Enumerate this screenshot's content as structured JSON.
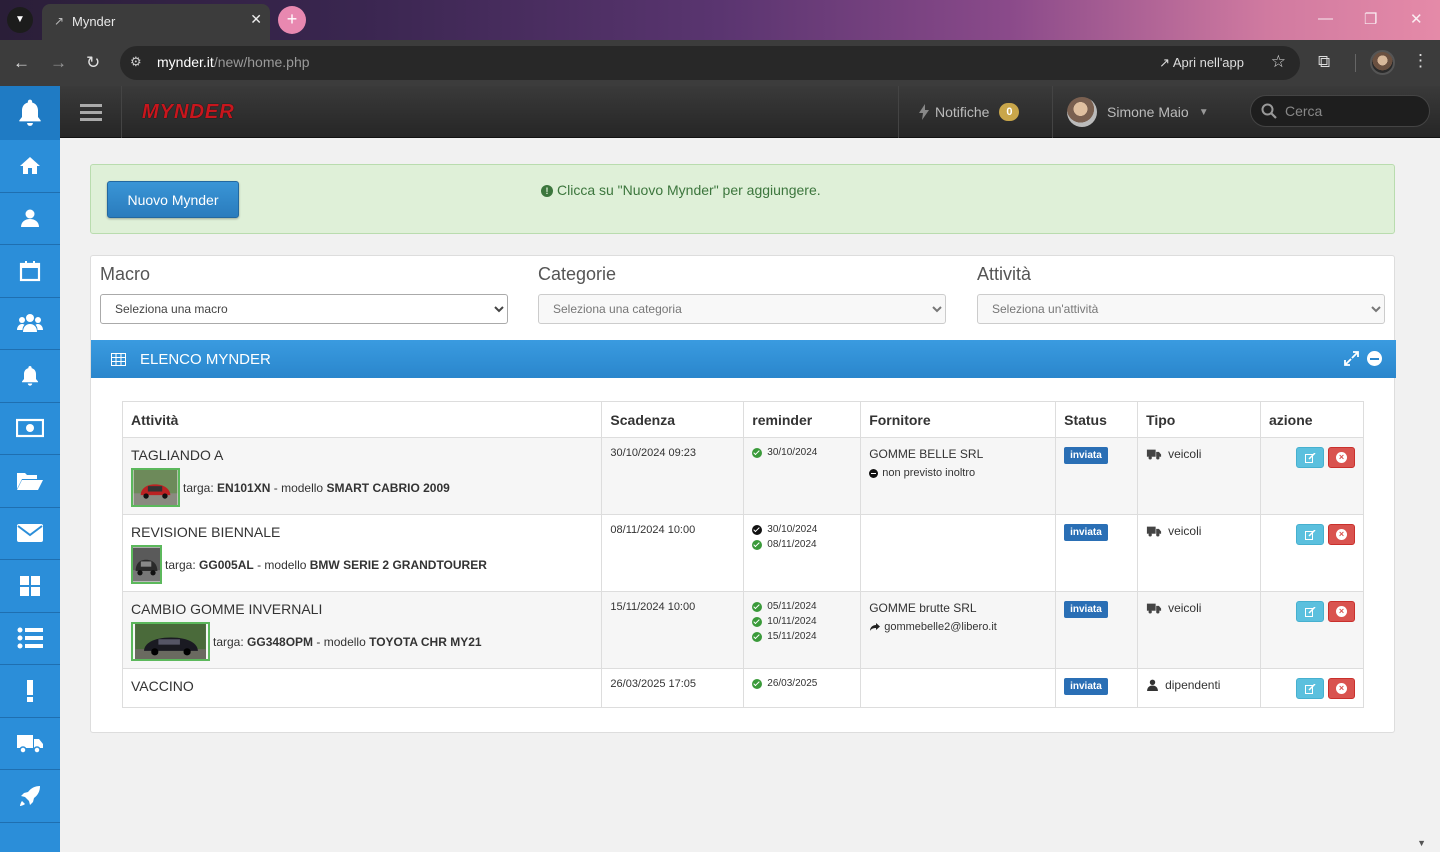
{
  "browser": {
    "tab_title": "Mynder",
    "url_domain": "mynder.it",
    "url_path": "/new/home.php",
    "open_in_app": "Apri nell'app"
  },
  "header": {
    "logo": "MYNDER",
    "notifications_label": "Notifiche",
    "notifications_count": "0",
    "user_name": "Simone Maio",
    "search_placeholder": "Cerca"
  },
  "alert": {
    "button_label": "Nuovo Mynder",
    "message": "Clicca su \"Nuovo Mynder\" per aggiungere."
  },
  "filters": {
    "macro_label": "Macro",
    "macro_value": "Seleziona una macro",
    "categorie_label": "Categorie",
    "categorie_value": "Seleziona una categoria",
    "attivita_label": "Attività",
    "attivita_value": "Seleziona un'attività"
  },
  "panel": {
    "title": "ELENCO MYNDER"
  },
  "table": {
    "headers": [
      "Attività",
      "Scadenza",
      "reminder",
      "Fornitore",
      "Status",
      "Tipo",
      "azione"
    ],
    "rows": [
      {
        "attivita": "TAGLIANDO A",
        "targa_label": "targa:",
        "targa": "EN101XN",
        "modello_label": "- modello",
        "modello": "SMART CABRIO 2009",
        "scadenza": "30/10/2024 09:23",
        "reminders": [
          "30/10/2024"
        ],
        "fornitore": "GOMME BELLE SRL",
        "fornitore_note": "non previsto inoltro",
        "status": "inviata",
        "tipo": "veicoli"
      },
      {
        "attivita": "REVISIONE BIENNALE",
        "targa_label": "targa:",
        "targa": "GG005AL",
        "modello_label": "- modello",
        "modello": "BMW SERIE 2 GRANDTOURER",
        "scadenza": "08/11/2024 10:00",
        "reminders": [
          "30/10/2024",
          "08/11/2024"
        ],
        "fornitore": "",
        "fornitore_note": "",
        "status": "inviata",
        "tipo": "veicoli"
      },
      {
        "attivita": "CAMBIO GOMME INVERNALI",
        "targa_label": "targa:",
        "targa": "GG348OPM",
        "modello_label": "- modello",
        "modello": "TOYOTA CHR MY21",
        "scadenza": "15/11/2024 10:00",
        "reminders": [
          "05/11/2024",
          "10/11/2024",
          "15/11/2024"
        ],
        "fornitore": "GOMME brutte SRL",
        "fornitore_note": "gommebelle2@libero.it",
        "status": "inviata",
        "tipo": "veicoli"
      },
      {
        "attivita": "VACCINO",
        "scadenza": "26/03/2025 17:05",
        "reminders": [
          "26/03/2025"
        ],
        "fornitore": "",
        "status": "inviata",
        "tipo": "dipendenti"
      }
    ]
  },
  "colors": {
    "sidebar": "#2b8ed9",
    "panel_header": "#2a86cc",
    "alert_bg": "#dff0d8",
    "status_label": "#2a6fb5",
    "edit_button": "#5bc0de",
    "delete_button": "#d9534f",
    "logo": "#c8161d"
  },
  "icons": {
    "sidebar": [
      "bell-icon",
      "home-icon",
      "user-icon",
      "calendar-icon",
      "users-icon",
      "bell-icon",
      "money-icon",
      "folder-open-icon",
      "envelope-icon",
      "dashboard-icon",
      "list-icon",
      "exclamation-icon",
      "truck-icon",
      "rocket-icon"
    ]
  }
}
